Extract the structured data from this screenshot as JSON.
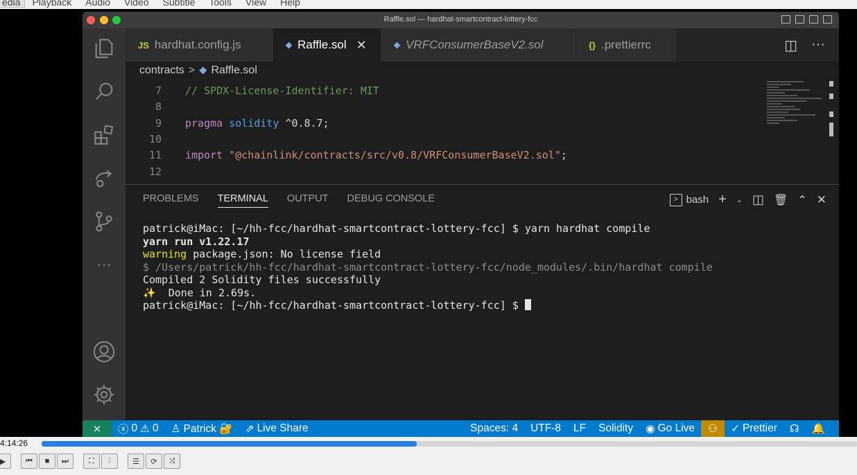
{
  "player_menu": [
    "edia",
    "Playback",
    "Audio",
    "Video",
    "Subtitle",
    "Tools",
    "View",
    "Help"
  ],
  "window": {
    "title": "Raffle.sol — hardhat-smartcontract-lottery-fcc"
  },
  "tabs": [
    {
      "icon": "JS",
      "label": "hardhat.config.js"
    },
    {
      "icon": "⬥",
      "label": "Raffle.sol",
      "close": "✕"
    },
    {
      "icon": "⬥",
      "label": "VRFConsumerBaseV2.sol"
    },
    {
      "icon": "{}",
      "label": ".prettierrc"
    }
  ],
  "breadcrumb": {
    "folder": "contracts",
    "separator": ">",
    "file": "Raffle.sol"
  },
  "editor": {
    "lines": [
      {
        "n": "7",
        "comment": "// SPDX-License-Identifier: MIT"
      },
      {
        "n": "8"
      },
      {
        "n": "9",
        "kw": "pragma",
        "type": "solidity",
        "rest": " ^0.8.7;"
      },
      {
        "n": "10"
      },
      {
        "n": "11",
        "kw": "import",
        "str": "\"@chainlink/contracts/src/v0.8/VRFConsumerBaseV2.sol\"",
        "rest": ";"
      },
      {
        "n": "12"
      }
    ]
  },
  "panel": {
    "tabs": [
      "PROBLEMS",
      "TERMINAL",
      "OUTPUT",
      "DEBUG CONSOLE"
    ],
    "shell": "bash"
  },
  "terminal": {
    "lines": [
      "patrick@iMac: [~/hh-fcc/hardhat-smartcontract-lottery-fcc] $ yarn hardhat compile",
      "yarn run v1.22.17",
      "warning",
      " package.json: No license field",
      "$ /Users/patrick/hh-fcc/hardhat-smartcontract-lottery-fcc/node_modules/.bin/hardhat compile",
      "Compiled 2 Solidity files successfully",
      "✨  Done in 2.69s.",
      "patrick@iMac: [~/hh-fcc/hardhat-smartcontract-lottery-fcc] $ "
    ]
  },
  "statusbar": {
    "errors": "0",
    "warnings": "0",
    "user": "Patrick 🔐",
    "live_share": "Live Share",
    "spaces": "Spaces: 4",
    "encoding": "UTF-8",
    "eol": "LF",
    "language": "Solidity",
    "go_live": "Go Live",
    "prettier": "Prettier"
  },
  "player": {
    "time": "4:14:26",
    "progress_fraction": 0.46
  }
}
